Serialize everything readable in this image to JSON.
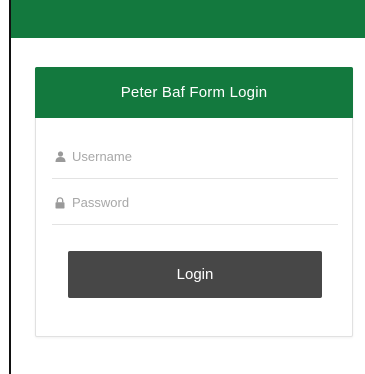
{
  "form": {
    "title": "Peter Baf Form Login",
    "username": {
      "value": "",
      "placeholder": "Username",
      "icon": "user-icon"
    },
    "password": {
      "value": "",
      "placeholder": "Password",
      "icon": "lock-icon"
    },
    "login_label": "Login"
  },
  "colors": {
    "brand_green": "#13793e",
    "button_dark": "#474747",
    "placeholder_gray": "#a8a8a8"
  }
}
